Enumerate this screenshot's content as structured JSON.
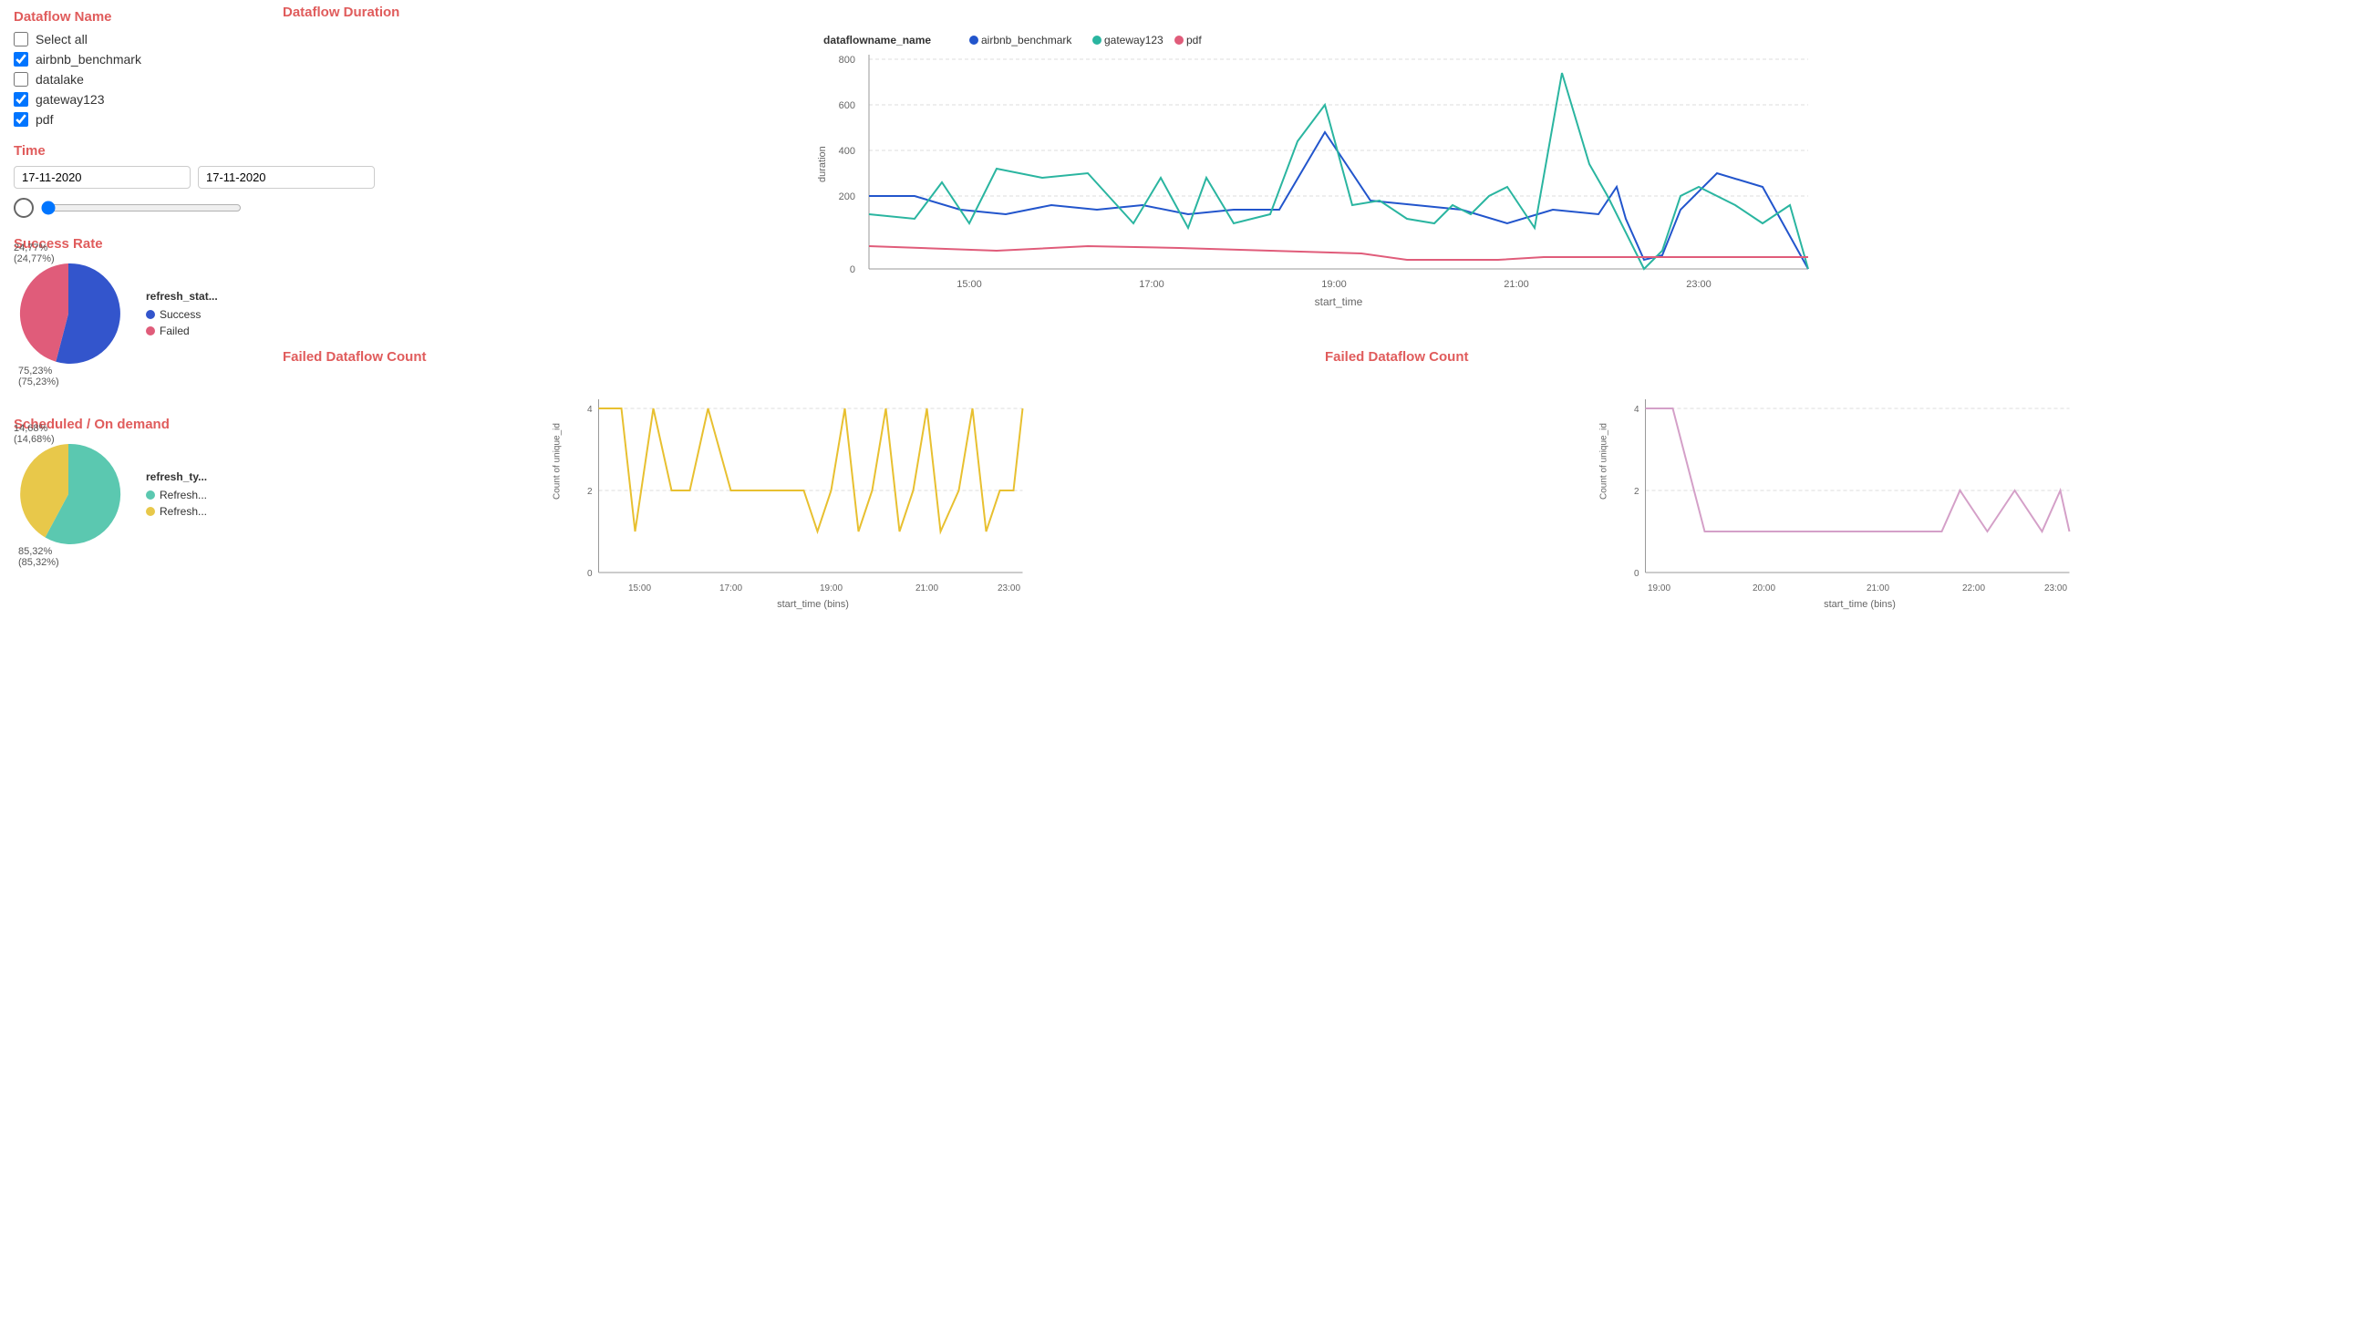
{
  "sidebar": {
    "dataflow_name_title": "Dataflow Name",
    "select_all_label": "Select all",
    "items": [
      {
        "label": "airbnb_benchmark",
        "checked": true
      },
      {
        "label": "datalake",
        "checked": false
      },
      {
        "label": "gateway123",
        "checked": true
      },
      {
        "label": "pdf",
        "checked": true
      }
    ],
    "time_title": "Time",
    "date_start": "17-11-2020",
    "date_end": "17-11-2020"
  },
  "duration_chart": {
    "title": "Dataflow Duration",
    "legend_label": "dataflowname_name",
    "legend": [
      {
        "name": "airbnb_benchmark",
        "color": "#2255cc"
      },
      {
        "name": "gateway123",
        "color": "#2ab5a0"
      },
      {
        "name": "pdf",
        "color": "#e05c7a"
      }
    ],
    "y_label": "duration",
    "x_label": "start_time",
    "x_ticks": [
      "15:00",
      "17:00",
      "19:00",
      "21:00",
      "23:00"
    ],
    "y_ticks": [
      "0",
      "200",
      "400",
      "600",
      "800"
    ]
  },
  "success_rate": {
    "title": "Success Rate",
    "legend_label": "refresh_stat...",
    "segments": [
      {
        "label": "Success",
        "value": 75.23,
        "display": "75,23%\n(75,23%)",
        "color": "#3355cc"
      },
      {
        "label": "Failed",
        "value": 24.77,
        "display": "24,77%\n(24,77%)",
        "color": "#e05c7a"
      }
    ]
  },
  "scheduled": {
    "title": "Scheduled / On demand",
    "legend_label": "refresh_ty...",
    "segments": [
      {
        "label": "Refresh...",
        "value": 85.32,
        "display": "85,32%\n(85,32%)",
        "color": "#5bc8b0"
      },
      {
        "label": "Refresh...",
        "value": 14.68,
        "display": "14,68%\n(14,68%)",
        "color": "#e8c84a"
      }
    ]
  },
  "failed_count_1": {
    "title": "Failed Dataflow Count",
    "y_label": "Count of unique_id",
    "x_label": "start_time (bins)",
    "x_ticks": [
      "15:00",
      "17:00",
      "19:00",
      "21:00",
      "23:00"
    ],
    "y_ticks": [
      "0",
      "2",
      "4"
    ],
    "color": "#e8c030"
  },
  "failed_count_2": {
    "title": "Failed Dataflow Count",
    "y_label": "Count of unique_id",
    "x_label": "start_time (bins)",
    "x_ticks": [
      "19:00",
      "20:00",
      "21:00",
      "22:00",
      "23:00"
    ],
    "y_ticks": [
      "0",
      "2",
      "4"
    ],
    "color": "#d4a0c8"
  }
}
